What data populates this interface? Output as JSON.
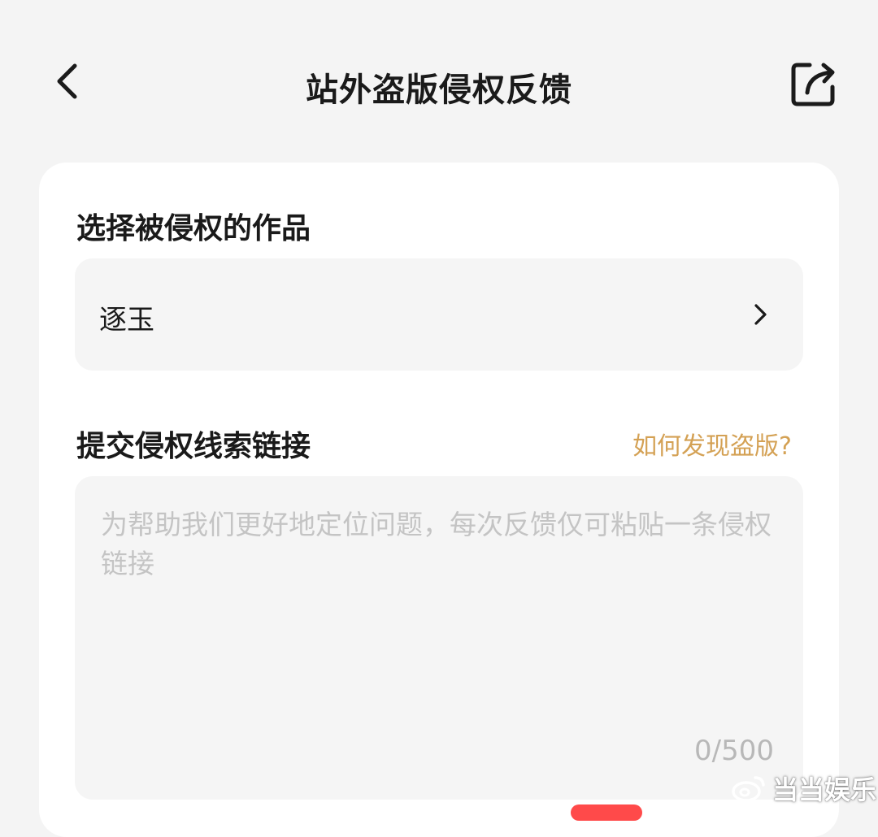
{
  "nav": {
    "title": "站外盗版侵权反馈",
    "back_icon": "chevron-left-icon",
    "share_icon": "share-icon"
  },
  "work_section": {
    "title": "选择被侵权的作品",
    "selected_work": "逐玉",
    "chevron_icon": "chevron-right-icon"
  },
  "link_section": {
    "title": "提交侵权线索链接",
    "help_link": "如何发现盗版?",
    "placeholder": "为帮助我们更好地定位问题，每次反馈仅可粘贴一条侵权链接",
    "value": "",
    "counter": "0/500"
  },
  "watermark": {
    "text": "当当娱乐",
    "icon": "weibo-logo-icon"
  },
  "colors": {
    "background": "#f4f4f4",
    "card": "#ffffff",
    "field": "#f5f5f5",
    "accent": "#d4a154",
    "placeholder": "#c4c4c4",
    "submit": "#ff4a4a"
  }
}
